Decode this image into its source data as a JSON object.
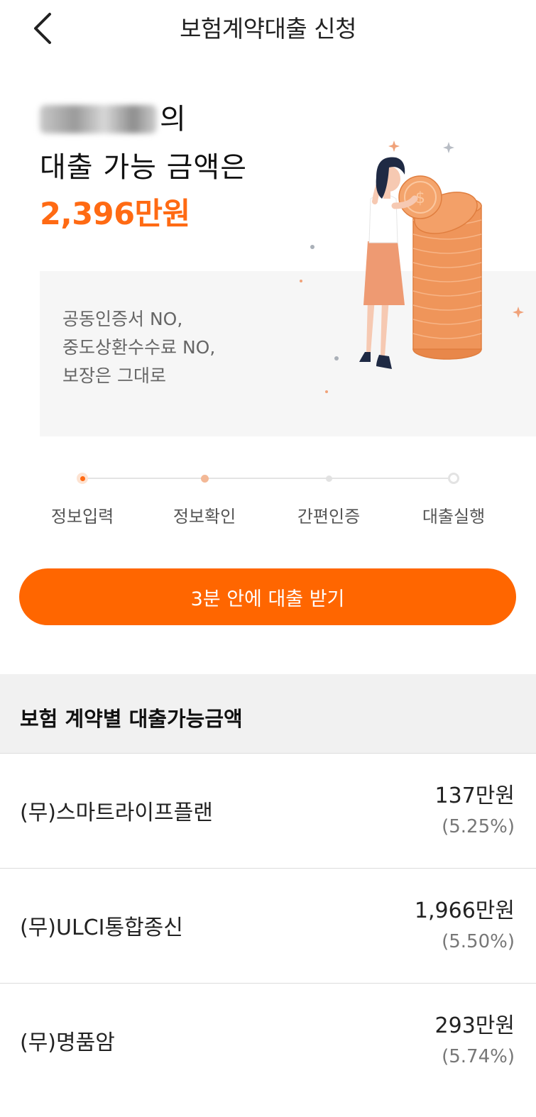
{
  "header": {
    "title": "보험계약대출 신청",
    "back_icon": "chevron-left-icon"
  },
  "hero": {
    "name_suffix": "의",
    "line2": "대출 가능 금액은",
    "amount": "2,396만원"
  },
  "promo": {
    "lines": [
      "공동인증서 NO,",
      "중도상환수수료 NO,",
      "보장은 그대로"
    ]
  },
  "steps": [
    {
      "label": "정보입력",
      "state": "current"
    },
    {
      "label": "정보확인",
      "state": "next"
    },
    {
      "label": "간편인증",
      "state": "pending"
    },
    {
      "label": "대출실행",
      "state": "final"
    }
  ],
  "cta": {
    "label": "3분 안에 대출 받기"
  },
  "section": {
    "title": "보험 계약별 대출가능금액"
  },
  "contracts": [
    {
      "name": "(무)스마트라이프플랜",
      "amount": "137만원",
      "rate": "(5.25%)"
    },
    {
      "name": "(무)ULCI통합종신",
      "amount": "1,966만원",
      "rate": "(5.50%)"
    },
    {
      "name": "(무)명품암",
      "amount": "293만원",
      "rate": "(5.74%)"
    }
  ],
  "colors": {
    "accent": "#ff6600",
    "amount": "#ff6a13",
    "section_bg": "#f1f1f1",
    "promo_bg": "#f6f6f6"
  }
}
